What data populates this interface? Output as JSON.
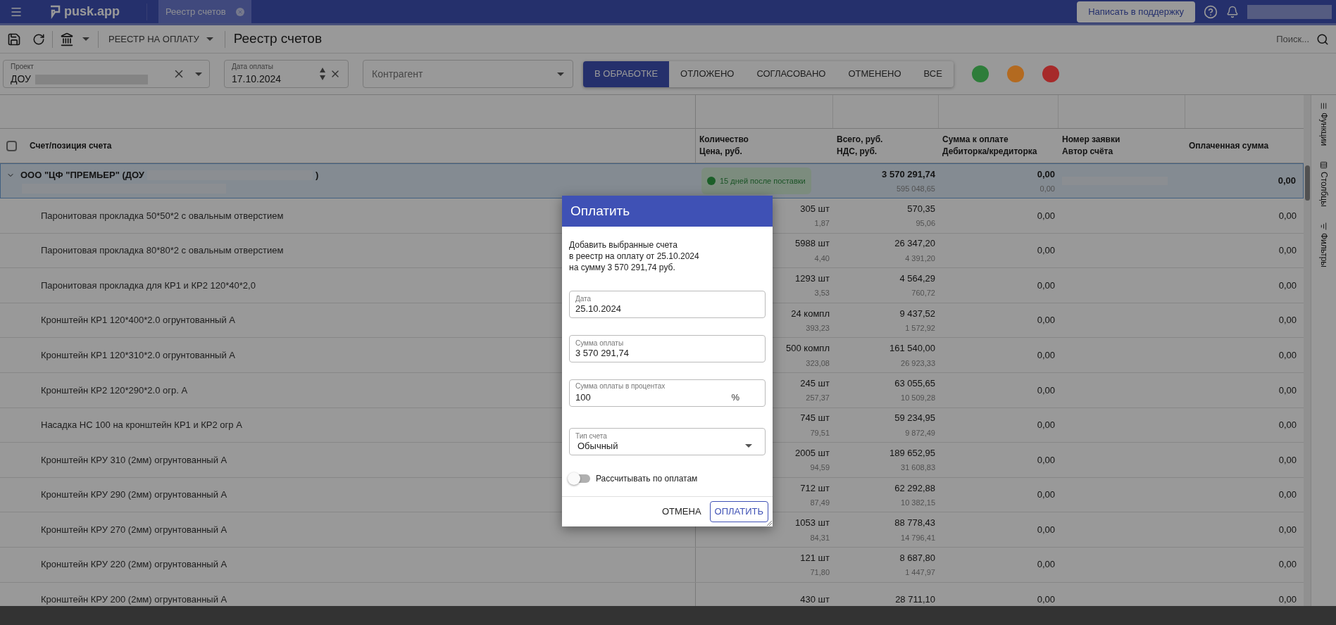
{
  "topbar": {
    "logo": "pusk.app",
    "tabs": [
      {
        "label": "Реестр счетов",
        "selected": true
      }
    ],
    "support_button": "Написать в поддержку"
  },
  "toolbar": {
    "registry_menu": "РЕЕСТР НА ОПЛАТУ",
    "title": "Реестр счетов",
    "search": {
      "placeholder": "Поиск..."
    }
  },
  "filters": {
    "project": {
      "label": "Проект",
      "value": "ДОУ"
    },
    "payment_date": {
      "label": "Дата оплаты",
      "value": "17.10.2024"
    },
    "counterparty": {
      "placeholder": "Контрагент"
    },
    "status_tabs": [
      {
        "label": "В ОБРАБОТКЕ",
        "selected": true
      },
      {
        "label": "ОТЛОЖЕНО",
        "selected": false
      },
      {
        "label": "СОГЛАСОВАНО",
        "selected": false
      },
      {
        "label": "ОТМЕНЕНО",
        "selected": false
      },
      {
        "label": "ВСЕ",
        "selected": false
      }
    ],
    "color_filters": [
      {
        "color": "#2e7d3a"
      },
      {
        "color": "#b36a20"
      },
      {
        "color": "#a62a2a"
      }
    ]
  },
  "table": {
    "select_all_checked": false,
    "columns": [
      {
        "line1": "Счет/позиция счета"
      },
      {
        "line1": "Количество",
        "line2": "Цена, руб."
      },
      {
        "line1": "Всего, руб.",
        "line2": "НДС, руб."
      },
      {
        "line1": "Сумма к оплате",
        "line2": "Дебиторка/кредиторка"
      },
      {
        "line1": "Номер заявки",
        "line2": "Автор счёта"
      },
      {
        "line1": "Оплаченная сумма"
      }
    ],
    "group": {
      "name": "ООО \"ЦФ \"ПРЕМЬЕР\" (ДОУ",
      "name_end": ")",
      "expanded": true,
      "term": "15 дней после поставки",
      "total": "3 570 291,74",
      "vat": "595 048,65",
      "to_pay": "0,00",
      "debt": "0,00",
      "paid": "0,00"
    },
    "rows": [
      {
        "name": "Паронитовая прокладка 50*50*2 с овальным отверстием",
        "qty": "305 шт",
        "price": "1,87",
        "total": "570,35",
        "vat": "95,06",
        "to_pay": "0,00",
        "paid": "0,00"
      },
      {
        "name": "Паронитовая прокладка 80*80*2 с овальным отверстием",
        "qty": "5988 шт",
        "price": "4,40",
        "total": "26 347,20",
        "vat": "4 391,20",
        "to_pay": "0,00",
        "paid": "0,00"
      },
      {
        "name": "Паронитовая прокладка для КР1 и КР2 120*40*2,0",
        "qty": "1293 шт",
        "price": "3,53",
        "total": "4 564,29",
        "vat": "760,72",
        "to_pay": "0,00",
        "paid": "0,00"
      },
      {
        "name": "Кронштейн КР1 120*400*2.0 огрунтованный А",
        "qty": "24 компл",
        "price": "393,23",
        "total": "9 437,52",
        "vat": "1 572,92",
        "to_pay": "0,00",
        "paid": "0,00"
      },
      {
        "name": "Кронштейн КР1 120*310*2.0 огрунтованный А",
        "qty": "500 компл",
        "price": "323,08",
        "total": "161 540,00",
        "vat": "26 923,33",
        "to_pay": "0,00",
        "paid": "0,00"
      },
      {
        "name": "Кронштейн КР2 120*290*2.0 огр. А",
        "qty": "245 шт",
        "price": "257,37",
        "total": "63 055,65",
        "vat": "10 509,28",
        "to_pay": "0,00",
        "paid": "0,00"
      },
      {
        "name": "Насадка НС 100 на кронштейн КР1 и КР2 огр А",
        "qty": "745 шт",
        "price": "79,51",
        "total": "59 234,95",
        "vat": "9 872,49",
        "to_pay": "0,00",
        "paid": "0,00"
      },
      {
        "name": "Кронштейн КРУ 310 (2мм) огрунтованный А",
        "qty": "2005 шт",
        "price": "94,59",
        "total": "189 652,95",
        "vat": "31 608,83",
        "to_pay": "0,00",
        "paid": "0,00"
      },
      {
        "name": "Кронштейн КРУ 290 (2мм) огрунтованный А",
        "qty": "712 шт",
        "price": "87,49",
        "total": "62 292,88",
        "vat": "10 382,15",
        "to_pay": "0,00",
        "paid": "0,00"
      },
      {
        "name": "Кронштейн КРУ 270 (2мм) огрунтованный А",
        "qty": "1053 шт",
        "price": "84,31",
        "total": "88 778,43",
        "vat": "14 796,41",
        "to_pay": "0,00",
        "paid": "0,00"
      },
      {
        "name": "Кронштейн КРУ 220 (2мм) огрунтованный А",
        "qty": "121 шт",
        "price": "71,80",
        "total": "8 687,80",
        "vat": "1 447,97",
        "to_pay": "0,00",
        "paid": "0,00"
      },
      {
        "name": "Кронштейн КРУ 200 (2мм) огрунтованный А",
        "qty": "430 шт",
        "total": "28 711,10",
        "to_pay": "0,00",
        "paid": "0,00"
      }
    ]
  },
  "side_panel": [
    "Функции",
    "Столбцы",
    "Фильтры"
  ],
  "dialog": {
    "title": "Оплатить",
    "message_lines": [
      "Добавить выбранные счета",
      "в реестр на оплату от 25.10.2024",
      "на сумму 3 570 291,74 руб."
    ],
    "fields": [
      {
        "kind": "text",
        "label": "Дата",
        "value": "25.10.2024"
      },
      {
        "kind": "text",
        "label": "Сумма оплаты",
        "value": "3 570 291,74"
      },
      {
        "kind": "percent",
        "label": "Сумма оплаты в процентах",
        "value": "100",
        "suffix": "%"
      },
      {
        "kind": "select",
        "label": "Тип счета",
        "value": "Обычный"
      }
    ],
    "toggle": {
      "label": "Рассчитывать по оплатам",
      "on": false
    },
    "buttons": [
      {
        "kind": "text",
        "label": "ОТМЕНА"
      },
      {
        "kind": "outlined",
        "label": "ОПЛАТИТЬ"
      }
    ]
  }
}
